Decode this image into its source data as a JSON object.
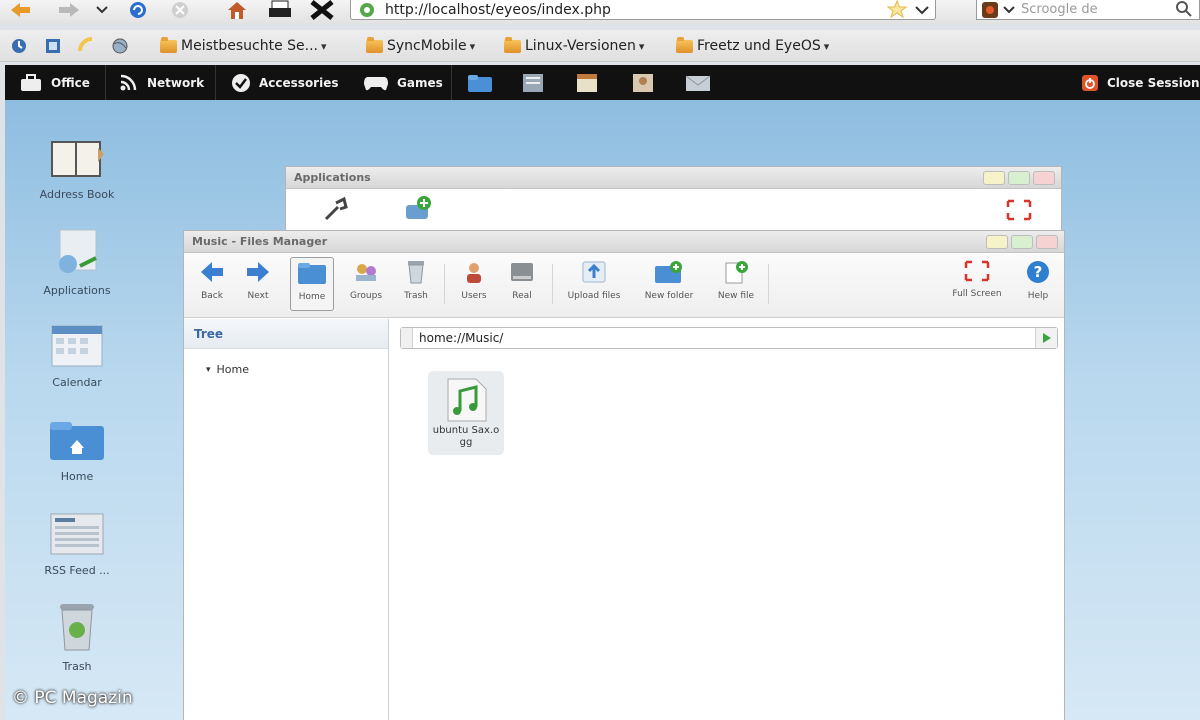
{
  "browser": {
    "url": "http://localhost/eyeos/index.php",
    "search_placeholder": "Scroogle de",
    "bookmarks": [
      {
        "label": "Meistbesuchte Se..."
      },
      {
        "label": "SyncMobile"
      },
      {
        "label": "Linux-Versionen"
      },
      {
        "label": "Freetz und EyeOS"
      }
    ]
  },
  "topbar": {
    "menus": [
      {
        "label": "Office",
        "icon": "briefcase-icon"
      },
      {
        "label": "Network",
        "icon": "rss-icon"
      },
      {
        "label": "Accessories",
        "icon": "checkmark-icon"
      },
      {
        "label": "Games",
        "icon": "gamepad-icon"
      }
    ],
    "close_session": "Close Session"
  },
  "desktop_icons": [
    {
      "label": "Address Book",
      "icon": "address-book-icon"
    },
    {
      "label": "Applications",
      "icon": "applications-icon"
    },
    {
      "label": "Calendar",
      "icon": "calendar-icon"
    },
    {
      "label": "Home",
      "icon": "home-folder-icon"
    },
    {
      "label": "RSS Feed ...",
      "icon": "rss-feed-icon"
    },
    {
      "label": "Trash",
      "icon": "trash-icon"
    }
  ],
  "applications_window": {
    "title": "Applications"
  },
  "files_window": {
    "title": "Music - Files Manager",
    "toolbar": {
      "back": "Back",
      "next": "Next",
      "home": "Home",
      "groups": "Groups",
      "trash": "Trash",
      "users": "Users",
      "real": "Real",
      "upload": "Upload files",
      "new_folder": "New folder",
      "new_file": "New file",
      "fullscreen": "Full Screen",
      "help": "Help"
    },
    "tree_header": "Tree",
    "tree_home": "Home",
    "path": "home://Music/",
    "file_name": "ubuntu Sax.ogg"
  },
  "watermark": "© PC Magazin",
  "colors": {
    "topbar": "#111111",
    "desktop": "#a9cde9",
    "accent": "#2f7fd1"
  }
}
